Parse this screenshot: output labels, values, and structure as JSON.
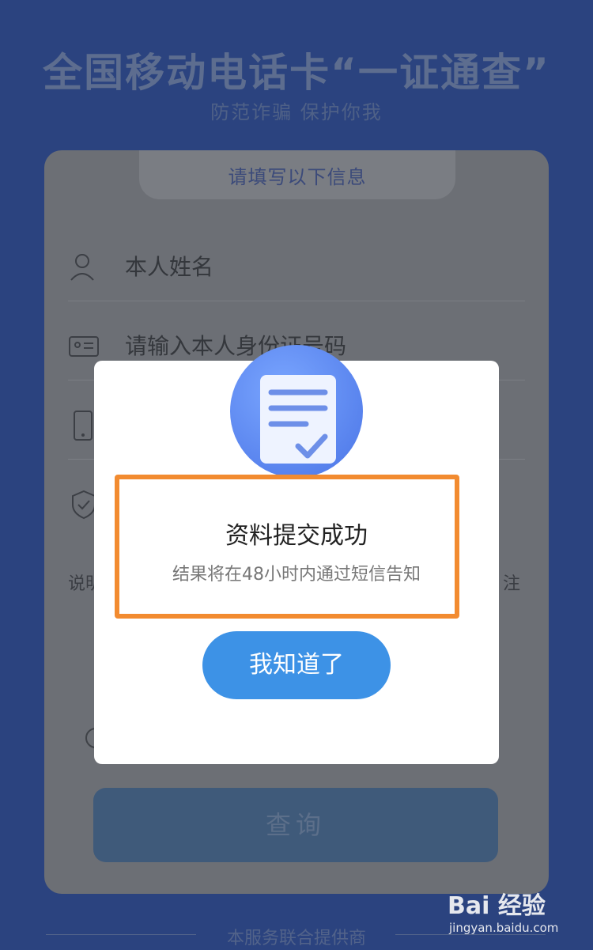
{
  "hero": {
    "title": "全国移动电话卡“一证通查”",
    "subtitle": "防范诈骗 保护你我"
  },
  "form": {
    "tab_label": "请填写以下信息",
    "fields": [
      {
        "icon": "person-icon",
        "text": "本人姓名"
      },
      {
        "icon": "id-card-icon",
        "text": "请输入本人身份证号码"
      },
      {
        "icon": "phone-icon",
        "text": ""
      },
      {
        "icon": "shield-icon",
        "text": ""
      }
    ],
    "note_left": "说明",
    "note_right": "注",
    "query_label": "查询"
  },
  "modal": {
    "title": "资料提交成功",
    "subtitle": "结果将在48小时内通过短信告知",
    "button_label": "我知道了"
  },
  "footer": {
    "text": "本服务联合提供商"
  },
  "watermark": {
    "brand": "Bai 经验",
    "url": "jingyan.baidu.com"
  },
  "colors": {
    "accent_blue": "#3d92e6",
    "highlight_orange": "#f28b30",
    "background_navy": "#2b437f"
  }
}
